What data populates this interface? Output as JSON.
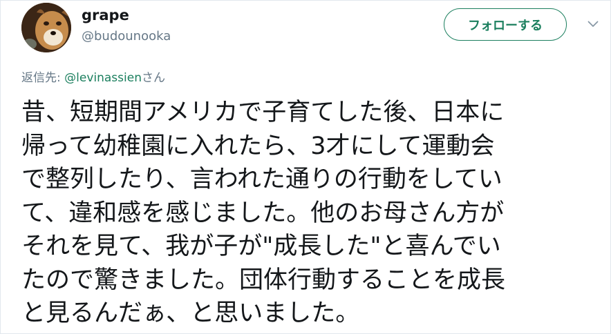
{
  "author": {
    "display_name": "grape",
    "screen_name": "@budounooka",
    "avatar_icon": "dog-avatar-icon"
  },
  "follow_button": {
    "label": "フォローする",
    "color": "#1b7f5e"
  },
  "menu_icon": "chevron-down-icon",
  "reply": {
    "prefix": "返信先: ",
    "mention": "@levinassien",
    "suffix": "さん"
  },
  "tweet": {
    "lines": [
      "昔、短期間アメリカで子育てした後、日本に",
      "帰って幼稚園に入れたら、3才にして運動会",
      "で整列したり、言われた通りの行動をしてい",
      "て、違和感を感じました。他のお母さん方が",
      "それを見て、我が子が\"成長した\"と喜んでい",
      "たので驚きました。団体行動することを成長",
      "と見るんだぁ、と思いました。"
    ]
  },
  "colors": {
    "text_primary": "#14171a",
    "text_secondary": "#657786",
    "accent": "#1b7f5e",
    "border": "#e1e8ed"
  }
}
